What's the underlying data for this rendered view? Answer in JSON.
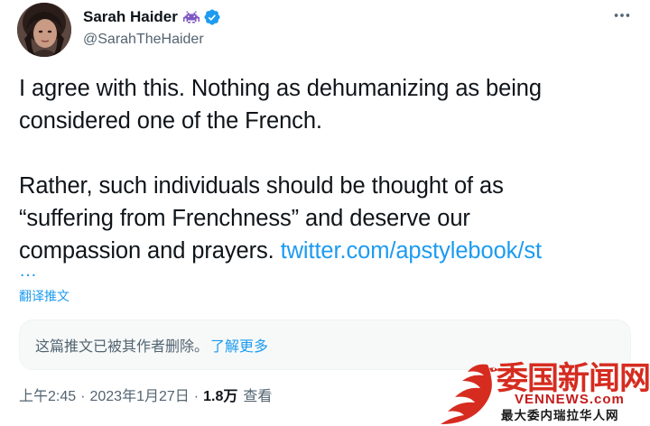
{
  "tweet": {
    "author": {
      "name": "Sarah Haider",
      "handle": "@SarahTheHaider",
      "emoji_icon": "space-invader-icon",
      "verified_icon": "verified-badge-icon"
    },
    "more_icon": "more-horizontal-icon",
    "text": {
      "line1": "I agree with this. Nothing as dehumanizing as being",
      "line2": "considered one of the French.",
      "line3": "Rather, such individuals should be thought of as",
      "line4": "“suffering from Frenchness” and deserve our",
      "line5_text": "compassion and prayers. ",
      "line5_link": "twitter.com/apstylebook/st",
      "ellipsis": "…"
    },
    "translate_label": "翻译推文",
    "deleted_notice": {
      "text": "这篇推文已被其作者删除。",
      "learn_more": "了解更多"
    },
    "meta": {
      "time": "上午2:45",
      "separator": "·",
      "date": "2023年1月27日",
      "views_count": "1.8万",
      "views_label": "查看"
    }
  },
  "watermark": {
    "title": "委国新闻网",
    "url": "VENNEWS.com",
    "subtitle": "最大委内瑞拉华人网"
  },
  "colors": {
    "link": "#1d9bf0",
    "text_primary": "#0f1419",
    "text_secondary": "#536471",
    "verified": "#1d9bf0",
    "watermark_red": "#d62c20"
  }
}
